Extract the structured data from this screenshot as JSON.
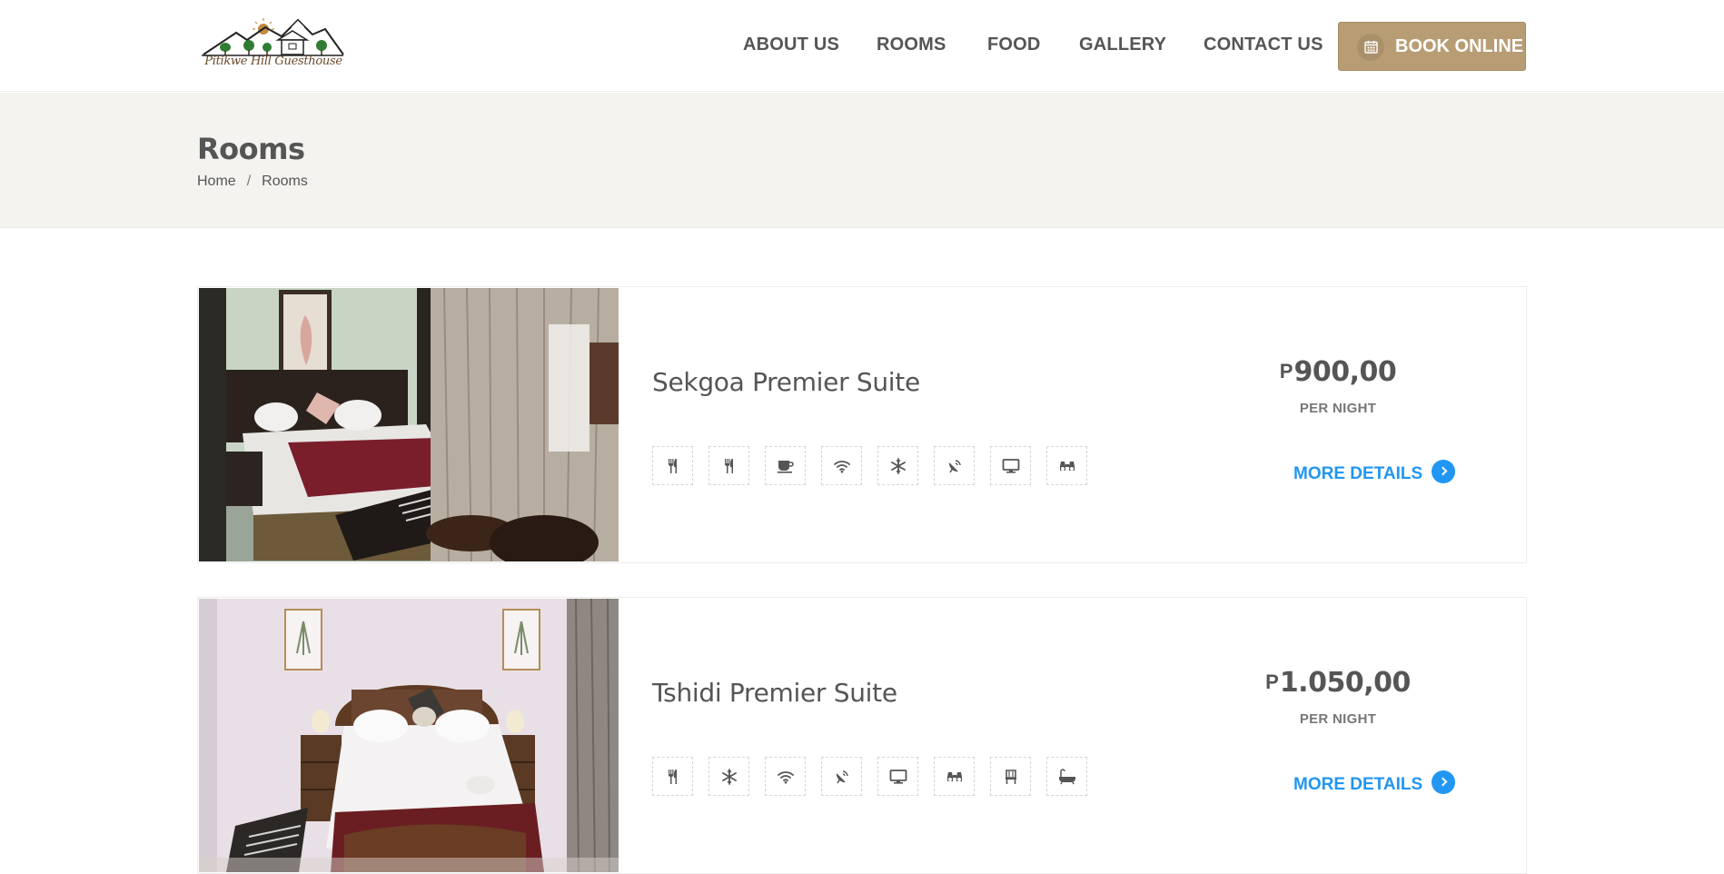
{
  "brand": {
    "logo_text": "Pitikwe Hill Guesthouse"
  },
  "nav": {
    "items": [
      "ABOUT US",
      "ROOMS",
      "FOOD",
      "GALLERY",
      "CONTACT US"
    ],
    "book_label": "BOOK ONLINE"
  },
  "page": {
    "title": "Rooms",
    "breadcrumb": {
      "home": "Home",
      "separator": "/",
      "current": "Rooms"
    }
  },
  "rooms": [
    {
      "name": "Sekgoa Premier Suite",
      "currency": "P",
      "price": "900,00",
      "per": "PER NIGHT",
      "more": "MORE DETAILS",
      "amenities": [
        "cutlery-icon",
        "cutlery-icon",
        "coffee-cup-icon",
        "wifi-icon",
        "snowflake-icon",
        "satellite-dish-icon",
        "monitor-icon",
        "binoculars-icon"
      ]
    },
    {
      "name": "Tshidi Premier Suite",
      "currency": "P",
      "price": "1.050,00",
      "per": "PER NIGHT",
      "more": "MORE DETAILS",
      "amenities": [
        "cutlery-icon",
        "snowflake-icon",
        "wifi-icon",
        "satellite-dish-icon",
        "monitor-icon",
        "binoculars-icon",
        "chair-icon",
        "bathtub-icon"
      ]
    }
  ],
  "colors": {
    "accent": "#b89c74",
    "link": "#2196f3",
    "band": "#f4f3f0",
    "text": "#555555"
  }
}
